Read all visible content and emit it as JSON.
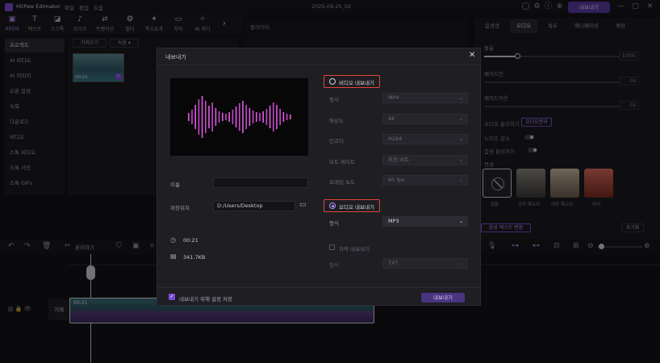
{
  "app": {
    "name": "HitPaw Edimakor",
    "menu": [
      "파일",
      "편집",
      "도움"
    ],
    "project_title": "2025-09-25_02",
    "export_button": "내보내기",
    "colors": {
      "accent": "#7b4bd6",
      "red_highlight": "#e0463a",
      "export_btn": "#5a3a9e"
    }
  },
  "toolbar": {
    "items": [
      {
        "label": "미디어",
        "icon": "media-icon"
      },
      {
        "label": "텍스트",
        "icon": "text-icon"
      },
      {
        "label": "스스톡",
        "icon": "sticker-icon"
      },
      {
        "label": "오디오",
        "icon": "audio-icon"
      },
      {
        "label": "트랜지션",
        "icon": "transition-icon"
      },
      {
        "label": "필터",
        "icon": "filter-icon"
      },
      {
        "label": "특수효과",
        "icon": "effects-icon"
      },
      {
        "label": "자막",
        "icon": "subtitle-icon"
      },
      {
        "label": "AI 미디",
        "icon": "ai-icon"
      }
    ]
  },
  "leftnav": {
    "items": [
      "프로젝트",
      "AI 비디오",
      "AI 이미지",
      "오픈 음성",
      "녹화",
      "다운로드",
      "비디오",
      "스톡 비디오",
      "스톡 사진",
      "스톡 GIFs"
    ]
  },
  "media": {
    "import_label": "가져오기",
    "record_label": "녹음",
    "clip_duration": "00:21"
  },
  "player": {
    "label": "플레이어"
  },
  "rightpanel": {
    "tabs": [
      "음성성",
      "오디오",
      "속도",
      "애니메이션",
      "색상"
    ],
    "volume_label": "볼륨",
    "volume_value": "100%",
    "fadein_label": "페이드인",
    "fadein_value": "0s",
    "fadeout_label": "페이드아웃",
    "fadeout_value": "0s",
    "audio_separate_label": "오디오 분리하기",
    "audio_separate_button": "오디오분리",
    "noise_label": "노이즈 감소",
    "voice_label": "음성 분리하기",
    "voice_changer_label": "변성",
    "voices": [
      "없음",
      "남자 목소리",
      "여자 목소리",
      "아이"
    ],
    "voice_btn": "음성 텍스트 변환",
    "reset_label": "초기화"
  },
  "timeline": {
    "split_label": "분리하기",
    "track_label": "기레",
    "clip_time": "00:21"
  },
  "export_modal": {
    "title": "내보내기",
    "video_export_label": "비디오 내보내기",
    "format_label": "형식",
    "format_value": "MP4",
    "resolution_label": "해상도",
    "resolution_value": "4K",
    "encoder_label": "인코더",
    "encoder_value": "H264",
    "bitrate_label": "비트 레이트",
    "bitrate_value": "추천 비트",
    "framerate_label": "프레임 속도",
    "framerate_value": "60 fps",
    "name_label": "이름",
    "name_value": "",
    "save_label": "저장위치",
    "save_value": "D:/Users/Desktop",
    "duration": "00:21",
    "filesize": "341.7KB",
    "audio_export_label": "오디오 내보내기",
    "audio_format_label": "형식",
    "audio_format_value": "MP3",
    "subtitle_export_label": "자막 내보내기",
    "subtitle_format_label": "형식",
    "subtitle_format_value": "TXT",
    "footer_checkbox_label": "내보내기 위해 설정 저장",
    "export_button": "내보내기"
  }
}
